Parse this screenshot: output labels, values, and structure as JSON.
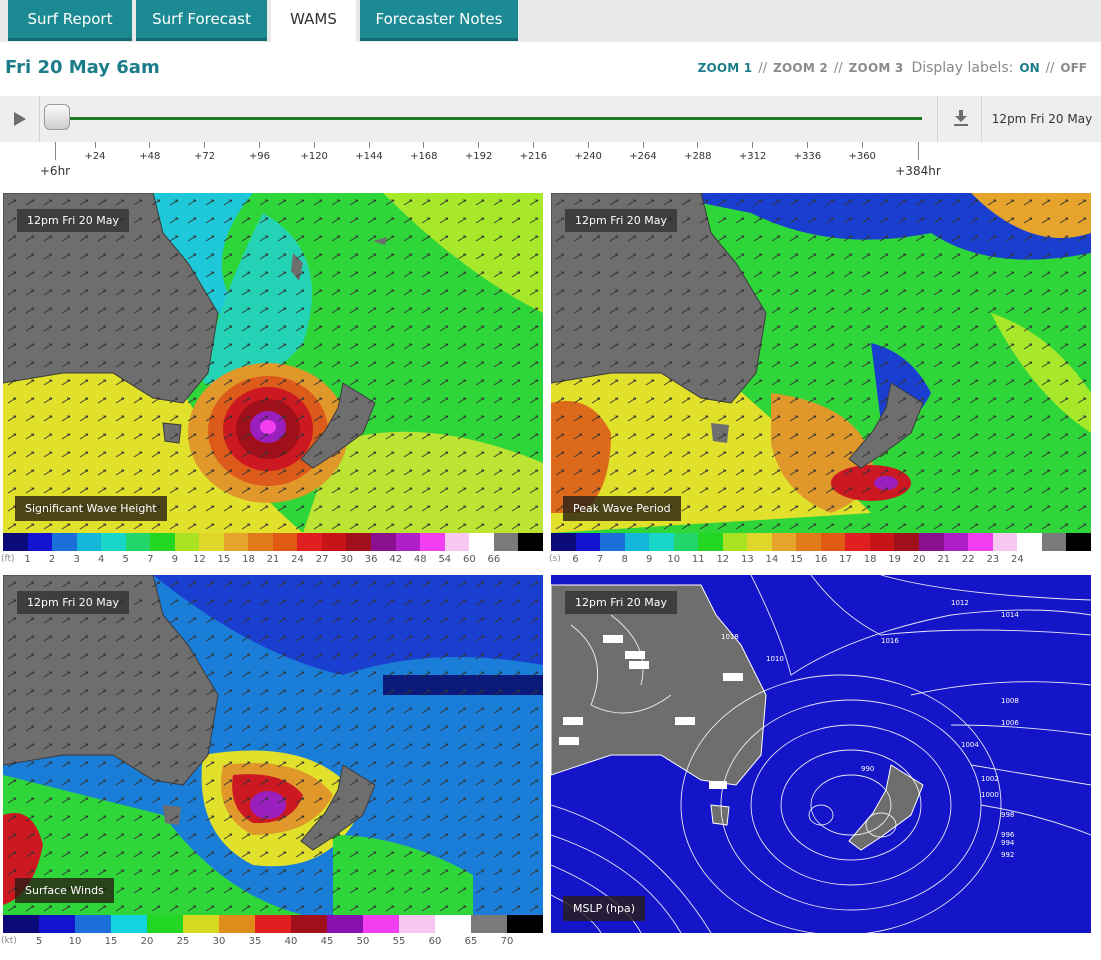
{
  "tabs": [
    {
      "label": "Surf Report",
      "active": false
    },
    {
      "label": "Surf Forecast",
      "active": false
    },
    {
      "label": "WAMS",
      "active": true
    },
    {
      "label": "Forecaster Notes",
      "active": false
    }
  ],
  "header": {
    "date_title": "Fri 20 May 6am",
    "zoom1": "ZOOM 1",
    "zoom2": "ZOOM 2",
    "zoom3": "ZOOM 3",
    "zoom_separator": "//",
    "display_labels": "Display labels:",
    "on": "ON",
    "off": "OFF",
    "active_zoom": "ZOOM 1",
    "labels_state": "ON"
  },
  "timeline": {
    "start_label": "+6hr",
    "end_label": "+384hr",
    "ticks": [
      "+24",
      "+48",
      "+72",
      "+96",
      "+120",
      "+144",
      "+168",
      "+192",
      "+216",
      "+240",
      "+264",
      "+288",
      "+312",
      "+336",
      "+360"
    ],
    "current_time": "12pm Fri 20 May",
    "position_fraction": 0.0
  },
  "panels": {
    "wave_height": {
      "timestamp": "12pm Fri 20 May",
      "label": "Significant Wave Height"
    },
    "wave_period": {
      "timestamp": "12pm Fri 20 May",
      "label": "Peak Wave Period"
    },
    "surface_winds": {
      "timestamp": "12pm Fri 20 May",
      "label": "Surface Winds"
    },
    "mslp": {
      "timestamp": "12pm Fri 20 May",
      "label": "MSLP (hpa)"
    }
  },
  "legends": {
    "wave_height": {
      "unit": "(ft)",
      "values": [
        "1",
        "2",
        "3",
        "4",
        "5",
        "7",
        "9",
        "12",
        "15",
        "18",
        "21",
        "24",
        "27",
        "30",
        "36",
        "42",
        "48",
        "54",
        "60",
        "66"
      ]
    },
    "wave_period": {
      "unit": "(s)",
      "values": [
        "6",
        "7",
        "8",
        "9",
        "10",
        "11",
        "12",
        "13",
        "14",
        "15",
        "16",
        "17",
        "18",
        "19",
        "20",
        "21",
        "22",
        "23",
        "24"
      ]
    },
    "surface_winds": {
      "unit": "(kt)",
      "values": [
        "5",
        "10",
        "15",
        "20",
        "25",
        "30",
        "35",
        "40",
        "45",
        "50",
        "55",
        "60",
        "65",
        "70"
      ]
    }
  },
  "isobar_labels": [
    "1012",
    "1014",
    "1016",
    "1018",
    "1010",
    "1008",
    "1006",
    "1004",
    "1002",
    "1000",
    "998",
    "996",
    "994",
    "992",
    "990"
  ],
  "colors": {
    "accent": "#1c7d88",
    "tab_bg": "#1c8a93",
    "land": "#6e6e6e",
    "ocean_mslp": "#1414c8",
    "track": "#1f7a1f"
  }
}
